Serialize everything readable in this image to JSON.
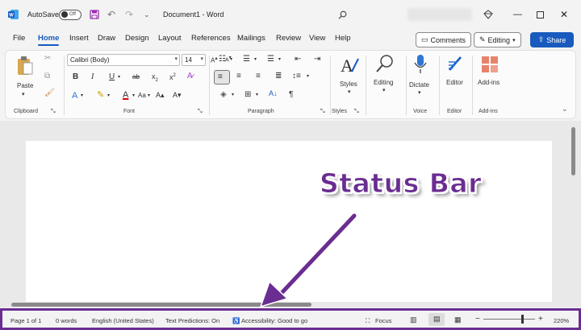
{
  "titlebar": {
    "app_icon": "word-logo-icon",
    "autosave_label": "AutoSave",
    "autosave_state": "Off",
    "document_title": "Document1 - Word",
    "icons": [
      "save-icon",
      "undo-icon",
      "redo-icon",
      "customize-qat-icon",
      "search-icon",
      "diamond-icon",
      "minimize-icon",
      "maximize-icon",
      "close-icon"
    ]
  },
  "menu": {
    "tabs": [
      "File",
      "Home",
      "Insert",
      "Draw",
      "Design",
      "Layout",
      "References",
      "Mailings",
      "Review",
      "View",
      "Help"
    ],
    "active_tab": "Home",
    "comments_label": "Comments",
    "editing_label": "Editing",
    "share_label": "Share"
  },
  "ribbon": {
    "clipboard": {
      "label": "Clipboard",
      "paste_label": "Paste"
    },
    "font": {
      "label": "Font",
      "font_name": "Calibri (Body)",
      "font_size": "14"
    },
    "paragraph": {
      "label": "Paragraph"
    },
    "styles": {
      "label": "Styles",
      "button_label": "Styles"
    },
    "editing": {
      "button_label": "Editing"
    },
    "voice": {
      "label": "Voice",
      "button_label": "Dictate"
    },
    "editor": {
      "label": "Editor",
      "button_label": "Editor"
    },
    "addins": {
      "label": "Add-ins",
      "button_label": "Add-ins"
    }
  },
  "annotation": {
    "text": "Status Bar",
    "color": "#6a2d91"
  },
  "statusbar": {
    "page": "Page 1 of 1",
    "words": "0 words",
    "language": "English (United States)",
    "predictions": "Text Predictions: On",
    "accessibility": "Accessibility: Good to go",
    "focus": "Focus",
    "zoom_percent": "220%",
    "zoom_slider_level": 0.75,
    "border_color": "#6a2d91"
  },
  "colors": {
    "accent": "#185abd",
    "highlight": "#6a2d91"
  }
}
